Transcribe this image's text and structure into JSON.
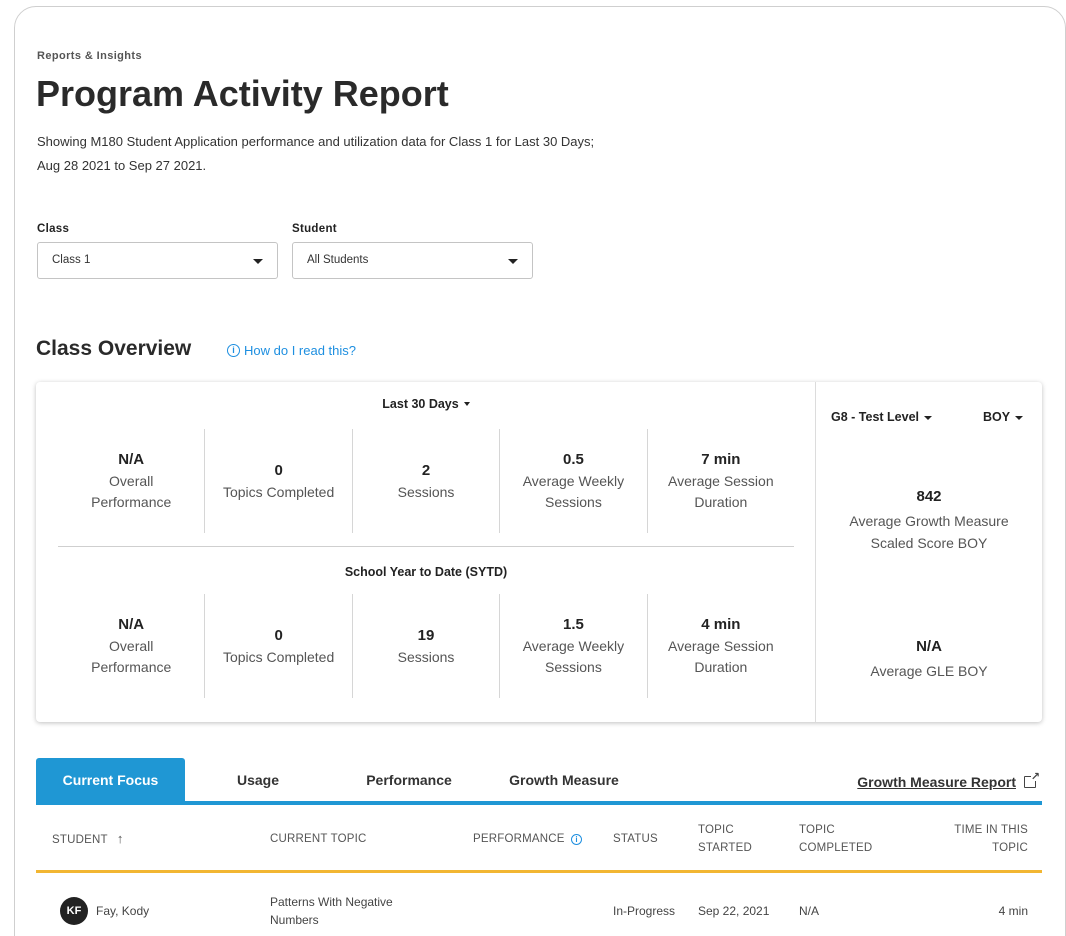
{
  "header": {
    "eyebrow": "Reports & Insights",
    "title": "Program Activity Report",
    "description": "Showing M180 Student Application performance and utilization data for Class 1 for Last 30 Days; Aug 28 2021 to Sep 27 2021."
  },
  "filters": {
    "class": {
      "label": "Class",
      "value": "Class 1"
    },
    "student": {
      "label": "Student",
      "value": "All Students"
    }
  },
  "overview": {
    "title": "Class Overview",
    "help_link": "How do I read this?",
    "last30": {
      "label": "Last 30 Days",
      "metrics": [
        {
          "value": "N/A",
          "label": "Overall Performance"
        },
        {
          "value": "0",
          "label": "Topics Completed"
        },
        {
          "value": "2",
          "label": "Sessions"
        },
        {
          "value": "0.5",
          "label": "Average Weekly Sessions"
        },
        {
          "value": "7 min",
          "label": "Average Session Duration"
        }
      ]
    },
    "sytd": {
      "label": "School Year to Date (SYTD)",
      "metrics": [
        {
          "value": "N/A",
          "label": "Overall Performance"
        },
        {
          "value": "0",
          "label": "Topics Completed"
        },
        {
          "value": "19",
          "label": "Sessions"
        },
        {
          "value": "1.5",
          "label": "Average Weekly Sessions"
        },
        {
          "value": "4 min",
          "label": "Average Session Duration"
        }
      ]
    },
    "side": {
      "test_level": "G8 - Test Level",
      "period": "BOY",
      "growth": {
        "value": "842",
        "label": "Average Growth Measure Scaled Score BOY"
      },
      "gle": {
        "value": "N/A",
        "label": "Average GLE BOY"
      }
    }
  },
  "tabs": {
    "items": [
      "Current Focus",
      "Usage",
      "Performance",
      "Growth Measure"
    ],
    "active": "Current Focus",
    "external_link": "Growth Measure Report"
  },
  "table": {
    "headers": {
      "student": "STUDENT",
      "current_topic": "CURRENT TOPIC",
      "performance": "PERFORMANCE",
      "status": "STATUS",
      "topic_started": "TOPIC STARTED",
      "topic_completed": "TOPIC COMPLETED",
      "time_in_topic": "TIME IN THIS TOPIC"
    },
    "rows": [
      {
        "initials": "KF",
        "student": "Fay, Kody",
        "current_topic": "Patterns With Negative Numbers",
        "performance": "",
        "status": "In-Progress",
        "topic_started": "Sep 22, 2021",
        "topic_completed": "N/A",
        "time_in_topic": "4 min"
      }
    ]
  },
  "colors": {
    "accent": "#1f97d4",
    "link": "#1e8fe0",
    "row_divider": "#f2b632"
  }
}
